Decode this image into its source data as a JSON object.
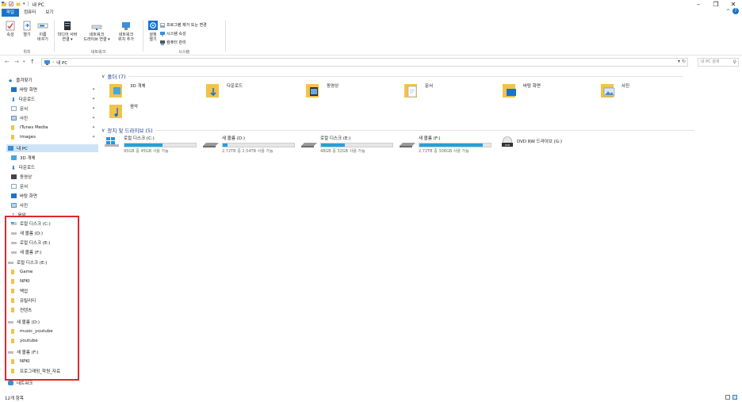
{
  "window": {
    "title": "내 PC"
  },
  "ribbon_tabs": [
    "파일",
    "컴퓨터",
    "보기"
  ],
  "ribbon": {
    "location_group": "위치",
    "network_group": "네트워크",
    "system_group": "시스템",
    "properties": "속성",
    "open": "열기",
    "rename_l1": "이름",
    "rename_l2": "바꾸기",
    "media_l1": "미디어 서버",
    "media_l2": "연결 ▾",
    "mapdrive_l1": "네트워크",
    "mapdrive_l2": "드라이브 연결 ▾",
    "addloc_l1": "네트워크",
    "addloc_l2": "위치 추가",
    "settings_l1": "설정",
    "settings_l2": "열기",
    "uninstall": "프로그램 제거 또는 변경",
    "sysprops": "시스템 속성",
    "manage": "컴퓨터 관리"
  },
  "address": {
    "crumb": "내 PC",
    "search_placeholder": "내 PC 검색"
  },
  "sidebar": {
    "quick_access": "즐겨찾기",
    "quick_items": [
      "바탕 화면",
      "다운로드",
      "문서",
      "사진",
      "iTunes Media",
      "images"
    ],
    "this_pc": "내 PC",
    "pc_items": [
      "3D 개체",
      "다운로드",
      "동영상",
      "문서",
      "바탕 화면",
      "사진",
      "음악"
    ],
    "drives": [
      "로컬 디스크 (C:)",
      "새 볼륨 (D:)",
      "로컬 디스크 (E:)",
      "새 볼륨 (F:)"
    ],
    "drive_e": "로컬 디스크 (E:)",
    "drive_e_items": [
      "Game",
      "NPKI",
      "백업",
      "유틸리티",
      "컨텐츠"
    ],
    "drive_d": "새 볼륨 (D:)",
    "drive_d_items": [
      "music_youtube",
      "youtube"
    ],
    "drive_f": "새 볼륨 (F:)",
    "drive_f_items": [
      "NPKI",
      "프로그래밍_학원_자료"
    ],
    "network": "네트워크"
  },
  "content": {
    "folders_header": "폴더 (7)",
    "folders": [
      "3D 개체",
      "다운로드",
      "동영상",
      "문서",
      "바탕 화면",
      "사진",
      "음악"
    ],
    "drives_header": "장치 및 드라이브 (5)",
    "drives": [
      {
        "name": "로컬 디스크 (C:)",
        "space": "95GB 중 45GB 사용 가능",
        "used_fraction": 0.53
      },
      {
        "name": "새 볼륨 (D:)",
        "space": "2.72TB 중 2.54TB 사용 가능",
        "used_fraction": 0.07
      },
      {
        "name": "로컬 디스크 (E:)",
        "space": "48GB 중 32GB 사용 가능",
        "used_fraction": 0.33
      },
      {
        "name": "새 볼륨 (F:)",
        "space": "2.72TB 중 306GB 사용 가능",
        "used_fraction": 0.89
      }
    ],
    "dvd": "DVD RW 드라이브 (G:)"
  },
  "status": {
    "count": "12개 항목"
  },
  "colors": {
    "accent": "#1a73c8",
    "selection": "#cce4f7",
    "drive_fill": "#26a0da",
    "highlight_box": "#e0282e",
    "group_header": "#1e3c8c"
  }
}
